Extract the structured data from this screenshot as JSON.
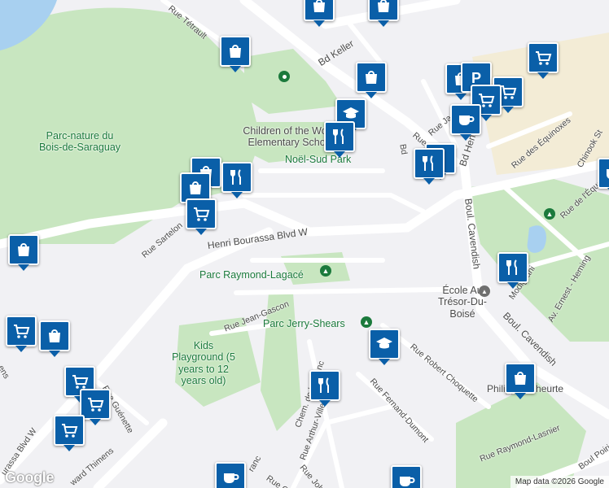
{
  "map": {
    "labels": {
      "parc_nature_1": "Parc-nature du",
      "parc_nature_2": "Bois-de-Saraguay",
      "school_1": "Children of the World",
      "school_2": "Elementary School",
      "noel_sud": "Noël-Sud Park",
      "raymond_lagace": "Parc Raymond-Lagacé",
      "jerry_shears": "Parc Jerry-Shears",
      "ecole_1": "École Au",
      "ecole_2": "Trésor-Du-Boisé",
      "kids": "Kids Playground (5 years to 12 years old)",
      "philippe": "Philippe-Laheurte",
      "henri": "Henri Bourassa Blvd W",
      "bd_keller": "Bd Keller",
      "cavendish_1": "Boul. Cavendish",
      "cavendish_2": "Boul. Cavendish",
      "bd_henri_east": "Bd Henri Bourassa",
      "rue_tetrault": "Rue Tétrault",
      "rue_sartelon": "Rue Sartelon",
      "rue_jean_gascon": "Rue Jean-Gascon",
      "rue_guenette": "Rue Guénette",
      "rue_robert": "Rue Robert Choquette",
      "rue_fernand": "Rue Fernand-Dumont",
      "rue_arthur": "Rue Arthur-Villeneuve",
      "chem": "Chem. de la Franc",
      "rue_raymond_lasnier": "Rue Raymond-Lasnier",
      "rue_john": "Rue John-L",
      "rue_equinoxes": "Rue des Équinoxes",
      "chinook": "Chinook St",
      "rue_de_lequat": "Rue de l'Équat",
      "modigliani": "Modigliani",
      "ernest": "Av. Ernest - Heming",
      "boul_poirier": "Boul Poirie",
      "blvd_w_sw": "urassa Blvd W",
      "thimens": "ward Thimens",
      "rue_ja": "Rue Ja",
      "rue_la": "Rue La",
      "bd_short": "Bd",
      "ens": "ens",
      "cel": "Rue Céle",
      "franc": "ranc"
    },
    "attribution": "Map data ©2026 Google",
    "logo": "Google",
    "colors": {
      "pin": "#0a5fa8",
      "park": "#c8e6c0",
      "road": "#ffffff",
      "water": "#a8d0f0",
      "sand": "#f3ecd6"
    },
    "pins": [
      {
        "type": "store",
        "icon": "grocery-cart"
      },
      {
        "type": "store",
        "icon": "grocery-cart"
      },
      {
        "type": "store",
        "icon": "shopping-bag"
      },
      {
        "type": "store",
        "icon": "shopping-bag"
      },
      {
        "type": "restaurant",
        "icon": "fork-knife"
      },
      {
        "type": "cafe",
        "icon": "coffee-cup"
      },
      {
        "type": "school",
        "icon": "graduation-cap"
      },
      {
        "type": "parking",
        "icon": "parking"
      }
    ]
  }
}
